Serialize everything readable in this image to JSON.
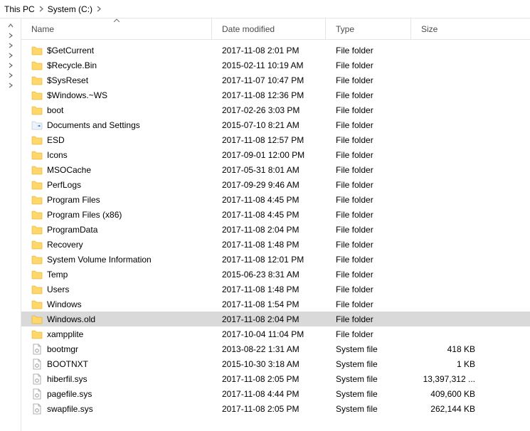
{
  "breadcrumb": {
    "items": [
      "This PC",
      "System (C:)"
    ]
  },
  "columns": {
    "name": "Name",
    "date": "Date modified",
    "type": "Type",
    "size": "Size",
    "sorted": "name",
    "sortdir": "asc"
  },
  "rows": [
    {
      "icon": "folder",
      "name": "$GetCurrent",
      "date": "2017-11-08 2:01 PM",
      "type": "File folder",
      "size": "",
      "selected": false
    },
    {
      "icon": "folder",
      "name": "$Recycle.Bin",
      "date": "2015-02-11 10:19 AM",
      "type": "File folder",
      "size": "",
      "selected": false
    },
    {
      "icon": "folder",
      "name": "$SysReset",
      "date": "2017-11-07 10:47 PM",
      "type": "File folder",
      "size": "",
      "selected": false
    },
    {
      "icon": "folder",
      "name": "$Windows.~WS",
      "date": "2017-11-08 12:36 PM",
      "type": "File folder",
      "size": "",
      "selected": false
    },
    {
      "icon": "folder",
      "name": "boot",
      "date": "2017-02-26 3:03 PM",
      "type": "File folder",
      "size": "",
      "selected": false
    },
    {
      "icon": "ffolder",
      "name": "Documents and Settings",
      "date": "2015-07-10 8:21 AM",
      "type": "File folder",
      "size": "",
      "selected": false
    },
    {
      "icon": "folder",
      "name": "ESD",
      "date": "2017-11-08 12:57 PM",
      "type": "File folder",
      "size": "",
      "selected": false
    },
    {
      "icon": "folder",
      "name": "Icons",
      "date": "2017-09-01 12:00 PM",
      "type": "File folder",
      "size": "",
      "selected": false
    },
    {
      "icon": "folder",
      "name": "MSOCache",
      "date": "2017-05-31 8:01 AM",
      "type": "File folder",
      "size": "",
      "selected": false
    },
    {
      "icon": "folder",
      "name": "PerfLogs",
      "date": "2017-09-29 9:46 AM",
      "type": "File folder",
      "size": "",
      "selected": false
    },
    {
      "icon": "folder",
      "name": "Program Files",
      "date": "2017-11-08 4:45 PM",
      "type": "File folder",
      "size": "",
      "selected": false
    },
    {
      "icon": "folder",
      "name": "Program Files (x86)",
      "date": "2017-11-08 4:45 PM",
      "type": "File folder",
      "size": "",
      "selected": false
    },
    {
      "icon": "folder",
      "name": "ProgramData",
      "date": "2017-11-08 2:04 PM",
      "type": "File folder",
      "size": "",
      "selected": false
    },
    {
      "icon": "folder",
      "name": "Recovery",
      "date": "2017-11-08 1:48 PM",
      "type": "File folder",
      "size": "",
      "selected": false
    },
    {
      "icon": "folder",
      "name": "System Volume Information",
      "date": "2017-11-08 12:01 PM",
      "type": "File folder",
      "size": "",
      "selected": false
    },
    {
      "icon": "folder",
      "name": "Temp",
      "date": "2015-06-23 8:31 AM",
      "type": "File folder",
      "size": "",
      "selected": false
    },
    {
      "icon": "folder",
      "name": "Users",
      "date": "2017-11-08 1:48 PM",
      "type": "File folder",
      "size": "",
      "selected": false
    },
    {
      "icon": "folder",
      "name": "Windows",
      "date": "2017-11-08 1:54 PM",
      "type": "File folder",
      "size": "",
      "selected": false
    },
    {
      "icon": "folder",
      "name": "Windows.old",
      "date": "2017-11-08 2:04 PM",
      "type": "File folder",
      "size": "",
      "selected": true
    },
    {
      "icon": "folder",
      "name": "xampplite",
      "date": "2017-10-04 11:04 PM",
      "type": "File folder",
      "size": "",
      "selected": false
    },
    {
      "icon": "sfile",
      "name": "bootmgr",
      "date": "2013-08-22 1:31 AM",
      "type": "System file",
      "size": "418 KB",
      "selected": false
    },
    {
      "icon": "sfile",
      "name": "BOOTNXT",
      "date": "2015-10-30 3:18 AM",
      "type": "System file",
      "size": "1 KB",
      "selected": false
    },
    {
      "icon": "sfile",
      "name": "hiberfil.sys",
      "date": "2017-11-08 2:05 PM",
      "type": "System file",
      "size": "13,397,312 ...",
      "selected": false
    },
    {
      "icon": "sfile",
      "name": "pagefile.sys",
      "date": "2017-11-08 4:44 PM",
      "type": "System file",
      "size": "409,600 KB",
      "selected": false
    },
    {
      "icon": "sfile",
      "name": "swapfile.sys",
      "date": "2017-11-08 2:05 PM",
      "type": "System file",
      "size": "262,144 KB",
      "selected": false
    }
  ]
}
